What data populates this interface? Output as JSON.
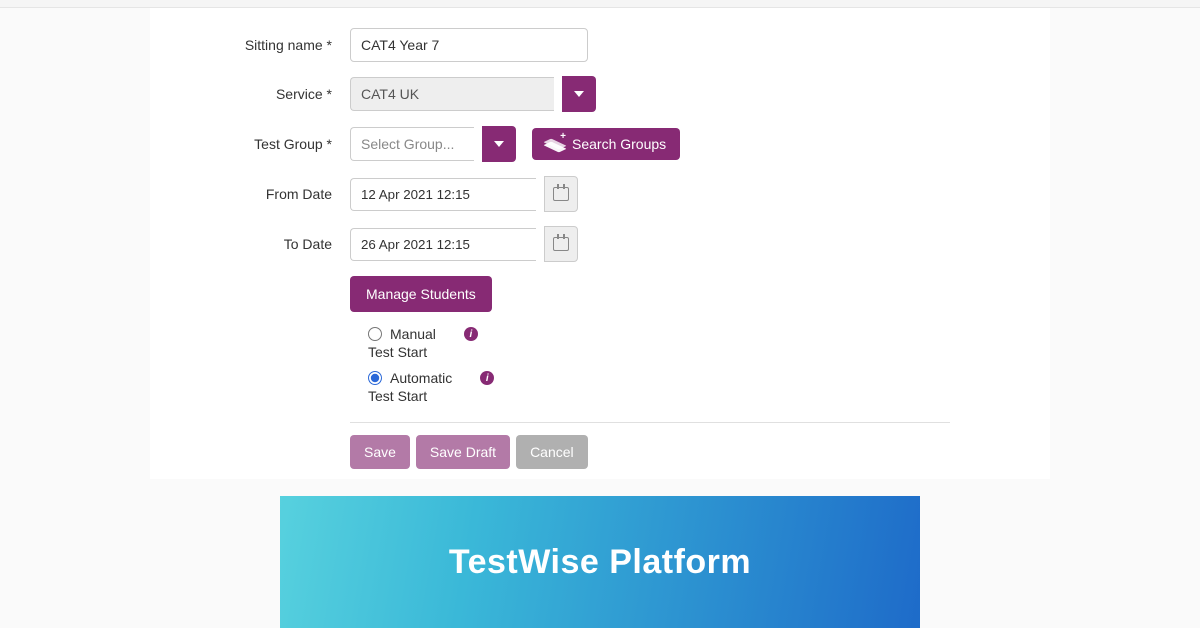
{
  "form": {
    "sitting_name_label": "Sitting name *",
    "sitting_name_value": "CAT4 Year 7",
    "service_label": "Service *",
    "service_value": "CAT4 UK",
    "test_group_label": "Test Group *",
    "test_group_placeholder": "Select Group...",
    "search_groups_label": "Search Groups",
    "from_date_label": "From Date",
    "from_date_value": "12 Apr 2021 12:15",
    "to_date_label": "To Date",
    "to_date_value": "26 Apr 2021 12:15",
    "manage_students_label": "Manage Students",
    "radios": {
      "manual": {
        "label": "Manual",
        "sublabel": "Test Start",
        "checked": false
      },
      "automatic": {
        "label": "Automatic",
        "sublabel": "Test Start",
        "checked": true
      }
    },
    "actions": {
      "save": "Save",
      "save_draft": "Save Draft",
      "cancel": "Cancel"
    }
  },
  "banner": {
    "title": "TestWise Platform"
  },
  "colors": {
    "accent": "#872a74",
    "radio_accent": "#2b68d8"
  }
}
